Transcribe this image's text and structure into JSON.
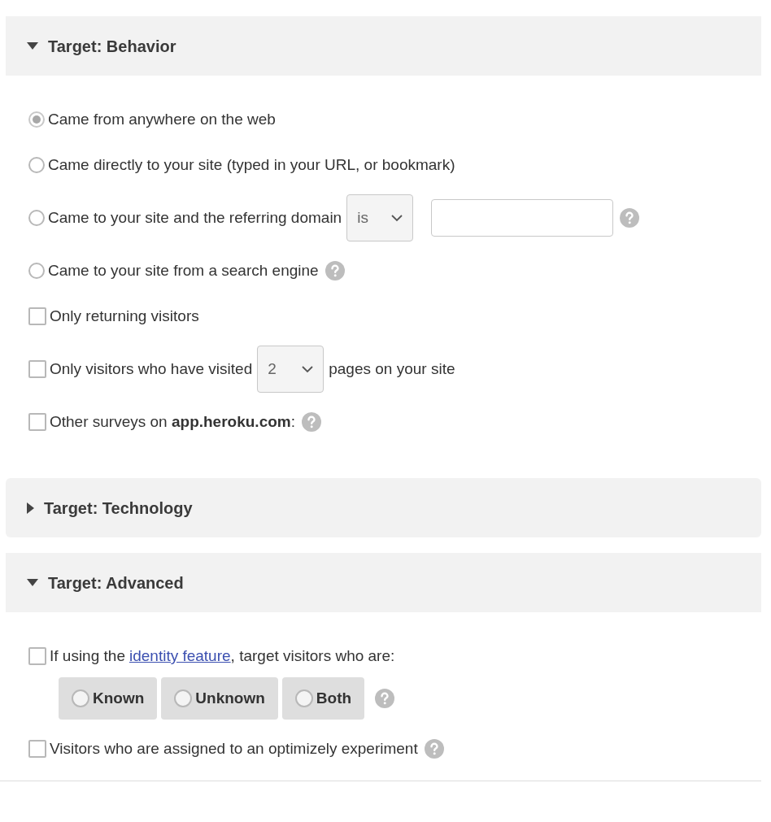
{
  "sections": [
    {
      "title": "Target: Behavior",
      "expanded": true,
      "items": [
        {
          "kind": "radio",
          "selected": true,
          "parts": [
            {
              "kind": "text",
              "text": "Came from anywhere on the web"
            }
          ]
        },
        {
          "kind": "radio",
          "selected": false,
          "parts": [
            {
              "kind": "text",
              "text": "Came directly to your site (typed in your URL, or bookmark)"
            }
          ]
        },
        {
          "kind": "radio",
          "selected": false,
          "parts": [
            {
              "kind": "text",
              "text": "Came to your site and the referring domain"
            },
            {
              "kind": "select",
              "value": "is"
            },
            {
              "kind": "input"
            },
            {
              "kind": "help"
            }
          ]
        },
        {
          "kind": "radio",
          "selected": false,
          "parts": [
            {
              "kind": "text",
              "text": "Came to your site from a search engine"
            },
            {
              "kind": "help"
            }
          ]
        },
        {
          "kind": "checkbox",
          "checked": false,
          "parts": [
            {
              "kind": "text",
              "text": "Only returning visitors"
            }
          ]
        },
        {
          "kind": "checkbox",
          "checked": false,
          "parts": [
            {
              "kind": "text",
              "text": "Only visitors who have visited"
            },
            {
              "kind": "select",
              "value": "2"
            },
            {
              "kind": "text",
              "text": "pages on your site"
            }
          ]
        },
        {
          "kind": "checkbox",
          "checked": false,
          "parts": [
            {
              "kind": "text",
              "text": "Other surveys on **app.heroku.com**:"
            },
            {
              "kind": "help"
            }
          ]
        }
      ]
    },
    {
      "title": "Target: Technology",
      "expanded": false
    },
    {
      "title": "Target: Advanced",
      "expanded": true,
      "items": [
        {
          "kind": "checkbox",
          "checked": false,
          "parts": [
            {
              "kind": "text",
              "text": "If using the"
            },
            {
              "kind": "link",
              "text": "identity feature"
            },
            {
              "kind": "text",
              "text": ", target visitors who are:"
            }
          ],
          "options": [
            {
              "label": "Known",
              "selected": false
            },
            {
              "label": "Unknown",
              "selected": false
            },
            {
              "label": "Both",
              "selected": false
            }
          ],
          "options_help": true
        },
        {
          "kind": "checkbox",
          "checked": false,
          "parts": [
            {
              "kind": "text",
              "text": "Visitors who are assigned to an optimizely experiment"
            },
            {
              "kind": "help"
            }
          ]
        }
      ]
    }
  ]
}
